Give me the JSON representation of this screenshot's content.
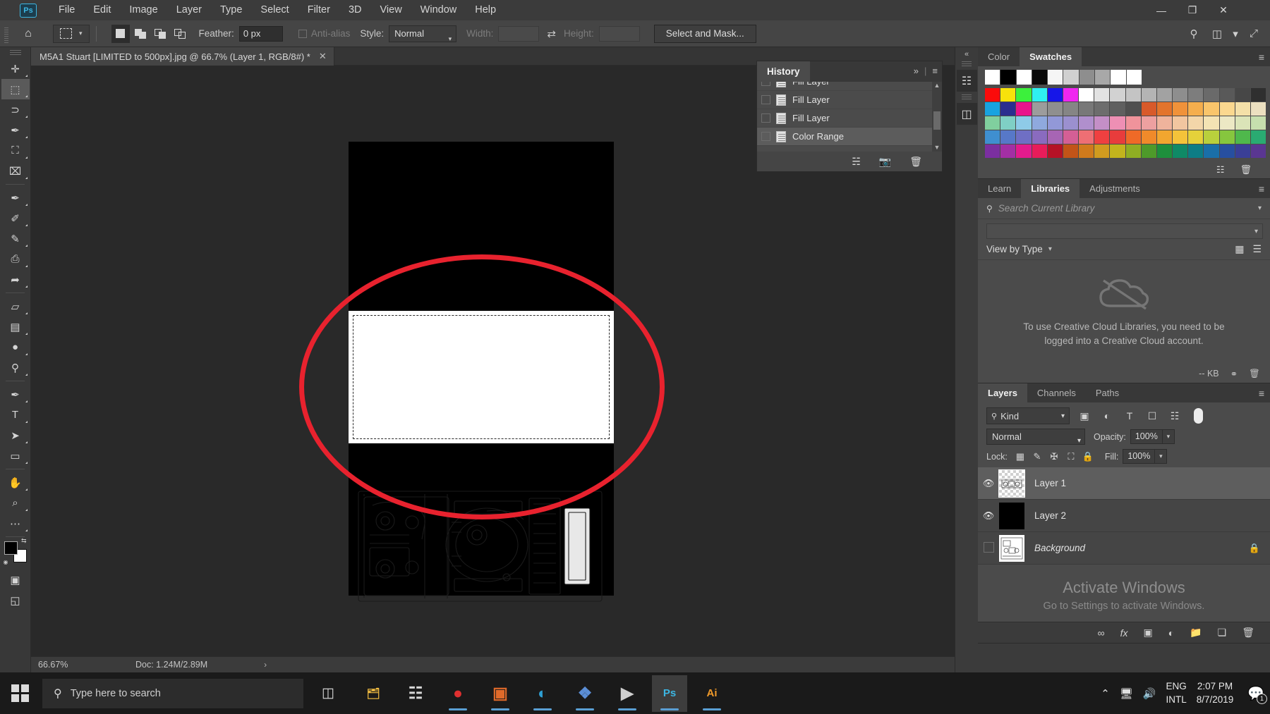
{
  "app": {
    "name": "Adobe Photoshop",
    "logo_text": "Ps"
  },
  "menubar": {
    "items": [
      "File",
      "Edit",
      "Image",
      "Layer",
      "Type",
      "Select",
      "Filter",
      "3D",
      "View",
      "Window",
      "Help"
    ],
    "window_controls": {
      "minimize": "—",
      "maximize": "❐",
      "close": "✕"
    }
  },
  "options_bar": {
    "home_icon": "⌂",
    "tool_icon": "marquee-tool",
    "feather_label": "Feather:",
    "feather_value": "0 px",
    "antialias_label": "Anti-alias",
    "style_label": "Style:",
    "style_value": "Normal",
    "width_label": "Width:",
    "width_value": "",
    "swap_icon": "⇄",
    "height_label": "Height:",
    "height_value": "",
    "select_and_mask": "Select and Mask...",
    "right_icons": [
      "search-icon",
      "workspace-icon",
      "chevron-down-icon",
      "share-icon"
    ]
  },
  "toolbar": {
    "tools": [
      {
        "name": "move-tool",
        "glyph": "✛"
      },
      {
        "name": "rectangular-marquee-tool",
        "glyph": "⬚"
      },
      {
        "name": "lasso-tool",
        "glyph": "⊃"
      },
      {
        "name": "quick-selection-tool",
        "glyph": "✒"
      },
      {
        "name": "crop-tool",
        "glyph": "⛶"
      },
      {
        "name": "frame-tool",
        "glyph": "⌧"
      },
      {
        "name": "eyedropper-tool",
        "glyph": "✒"
      },
      {
        "name": "spot-healing-brush-tool",
        "glyph": "✐"
      },
      {
        "name": "brush-tool",
        "glyph": "✎"
      },
      {
        "name": "clone-stamp-tool",
        "glyph": "⎙"
      },
      {
        "name": "history-brush-tool",
        "glyph": "➦"
      },
      {
        "name": "eraser-tool",
        "glyph": "▱"
      },
      {
        "name": "gradient-tool",
        "glyph": "▤"
      },
      {
        "name": "blur-tool",
        "glyph": "●"
      },
      {
        "name": "dodge-tool",
        "glyph": "⚲"
      },
      {
        "name": "pen-tool",
        "glyph": "✒"
      },
      {
        "name": "type-tool",
        "glyph": "T"
      },
      {
        "name": "path-selection-tool",
        "glyph": "➤"
      },
      {
        "name": "rectangle-tool",
        "glyph": "▭"
      },
      {
        "name": "hand-tool",
        "glyph": "✋"
      },
      {
        "name": "zoom-tool",
        "glyph": "⌕"
      },
      {
        "name": "more-tools",
        "glyph": "⋯"
      }
    ],
    "foreground_color": "#000000",
    "background_color": "#ffffff",
    "quick-mask": "▣",
    "screen-mode": "◱"
  },
  "document": {
    "tab_title": "M5A1 Stuart [LIMITED to 500px].jpg @ 66.7% (Layer 1, RGB/8#) *",
    "close_glyph": "✕",
    "canvas_background": "#000000",
    "selection_highlight_color": "#e8222e"
  },
  "status_bar": {
    "zoom": "66.67%",
    "doc_size": "Doc: 1.24M/2.89M",
    "chevron": "›"
  },
  "history_panel": {
    "tab": "History",
    "collapse_icon": "»",
    "menu_icon": "≡",
    "items": [
      {
        "label": "Fill Layer",
        "selected": false,
        "partial": true
      },
      {
        "label": "Fill Layer",
        "selected": false
      },
      {
        "label": "Fill Layer",
        "selected": false
      },
      {
        "label": "Color Range",
        "selected": true
      }
    ],
    "footer_icons": [
      "new-document-from-state-icon",
      "create-snapshot-icon",
      "delete-icon"
    ]
  },
  "color_panel": {
    "tabs": [
      {
        "label": "Color",
        "active": false
      },
      {
        "label": "Swatches",
        "active": true
      }
    ],
    "menu_icon": "≡",
    "grayscale_row": [
      "#ffffff",
      "#000000",
      "#ffffff",
      "#0a0a0a",
      "#f5f5f5",
      "#d0d0d0",
      "#8e8e8e",
      "#a8a8a8",
      "#ffffff",
      "#ffffff"
    ],
    "rows": [
      [
        "#fb0b0b",
        "#f7e20b",
        "#3cf03c",
        "#2ff0f0",
        "#1616e8",
        "#ef26ef",
        "#ffffff",
        "#e2e2e2",
        "#d2d2d2",
        "#c4c4c4",
        "#b4b4b4",
        "#a2a2a2",
        "#8e8e8e",
        "#7d7d7d",
        "#6a6a6a",
        "#595959",
        "#474747",
        "#2f2f2f"
      ],
      [
        "#18a3e0",
        "#2b2f8f",
        "#e8138b",
        "#9c9c9c",
        "#8f8f8f",
        "#858585",
        "#787878",
        "#6d6d6d",
        "#5f5f5f",
        "#4f4f4f",
        "#d85a2a",
        "#e3742c",
        "#f0923a",
        "#f5ae4d",
        "#fac56b",
        "#fbd88f",
        "#f4e0a8",
        "#ece0c0"
      ],
      [
        "#80cf9e",
        "#7fd0c5",
        "#8ecbe8",
        "#8fa9de",
        "#9298d8",
        "#9b90cf",
        "#b08fcd",
        "#c48fc7",
        "#ee8fb4",
        "#f0939b",
        "#eda0a0",
        "#efb39c",
        "#f2c6a0",
        "#f3d6a9",
        "#f4e3b4",
        "#ece8c4",
        "#dbe4b8",
        "#c6dfae"
      ],
      [
        "#3f8fd0",
        "#5778c8",
        "#6f6fc4",
        "#8a6bbf",
        "#a765b4",
        "#d45f95",
        "#ee6f74",
        "#ef4040",
        "#e83c3c",
        "#ef6a27",
        "#f08a2a",
        "#f2a62f",
        "#f4c33a",
        "#e5d13a",
        "#b9d03c",
        "#86c63e",
        "#4fb84c",
        "#2aab72"
      ],
      [
        "#7b2fa0",
        "#a32fa4",
        "#e21b8d",
        "#e81c5a",
        "#b51226",
        "#c25418",
        "#d07a1c",
        "#d19b1f",
        "#c2b41d",
        "#8fae23",
        "#4e9a2a",
        "#1e8f3c",
        "#0f8a66",
        "#0d7d85",
        "#1a6fa8",
        "#274fa0",
        "#3a3f97",
        "#5a3691"
      ]
    ],
    "footer_icons": [
      "new-swatch-icon",
      "delete-swatch-icon"
    ]
  },
  "libraries_panel": {
    "tabs": [
      {
        "label": "Learn",
        "active": false
      },
      {
        "label": "Libraries",
        "active": true
      },
      {
        "label": "Adjustments",
        "active": false
      }
    ],
    "menu_icon": "≡",
    "search_placeholder": "Search Current Library",
    "search_value": "",
    "library_select_value": "",
    "view_label": "View by Type",
    "view_icons": [
      "grid-view-icon",
      "list-view-icon"
    ],
    "empty_message": "To use Creative Cloud Libraries, you need to be logged into a Creative Cloud account.",
    "cc_icon": "creative-cloud-icon",
    "footer_size": "-- KB",
    "footer_icons": [
      "sync-icon",
      "delete-icon"
    ]
  },
  "layers_panel": {
    "tabs": [
      {
        "label": "Layers",
        "active": true
      },
      {
        "label": "Channels",
        "active": false
      },
      {
        "label": "Paths",
        "active": false
      }
    ],
    "menu_icon": "≡",
    "filter_label": "Kind",
    "filter_icons": [
      "pixel-filter-icon",
      "adjustment-filter-icon",
      "type-filter-icon",
      "shape-filter-icon",
      "smart-object-filter-icon"
    ],
    "blend_mode": "Normal",
    "opacity_label": "Opacity:",
    "opacity_value": "100%",
    "lock_label": "Lock:",
    "lock_icons": [
      "lock-transparent-pixels-icon",
      "lock-image-pixels-icon",
      "lock-position-icon",
      "lock-artboard-icon",
      "lock-all-icon"
    ],
    "fill_label": "Fill:",
    "fill_value": "100%",
    "layers": [
      {
        "name": "Layer 1",
        "visible": true,
        "selected": true,
        "locked": false,
        "italic": false,
        "thumb": "checker"
      },
      {
        "name": "Layer 2",
        "visible": true,
        "selected": false,
        "locked": false,
        "italic": false,
        "thumb": "black"
      },
      {
        "name": "Background",
        "visible": false,
        "selected": false,
        "locked": true,
        "italic": true,
        "thumb": "image"
      }
    ],
    "footer_icons": [
      "link-layers-icon",
      "layer-style-icon",
      "layer-mask-icon",
      "adjustment-layer-icon",
      "new-group-icon",
      "new-layer-icon",
      "delete-layer-icon"
    ]
  },
  "watermark": {
    "title": "Activate Windows",
    "subtitle": "Go to Settings to activate Windows."
  },
  "taskbar": {
    "start_icon": "windows-logo-icon",
    "search_placeholder": "Type here to search",
    "search_icon": "search-icon",
    "task_view_icon": "task-view-icon",
    "apps": [
      {
        "name": "file-explorer-icon",
        "glyph": "🗂",
        "color": "#f5bf42",
        "running": false
      },
      {
        "name": "microsoft-store-icon",
        "glyph": "☷",
        "color": "#d8d8d8",
        "running": false
      },
      {
        "name": "opera-browser-icon",
        "glyph": "●",
        "color": "#e03030",
        "running": true
      },
      {
        "name": "paint-3d-icon",
        "glyph": "▣",
        "color": "#e06a2a",
        "running": true
      },
      {
        "name": "edge-browser-icon",
        "glyph": "◐",
        "color": "#2e9fd4",
        "running": true
      },
      {
        "name": "teams-icon",
        "glyph": "❖",
        "color": "#5b8ed6",
        "running": true
      },
      {
        "name": "video-editor-icon",
        "glyph": "▶",
        "color": "#cfcfcf",
        "running": true
      },
      {
        "name": "photoshop-icon",
        "glyph": "Ps",
        "color": "#3cb6e3",
        "running": true,
        "current": true
      },
      {
        "name": "illustrator-icon",
        "glyph": "Ai",
        "color": "#f09a2a",
        "running": true
      }
    ],
    "tray": {
      "overflow_icon": "⌃",
      "network_icon": "network-icon",
      "volume_icon": "volume-icon",
      "language_line1": "ENG",
      "language_line2": "INTL",
      "time": "2:07 PM",
      "date": "8/7/2019",
      "notification_icon": "action-center-icon",
      "notification_count": "1"
    }
  }
}
